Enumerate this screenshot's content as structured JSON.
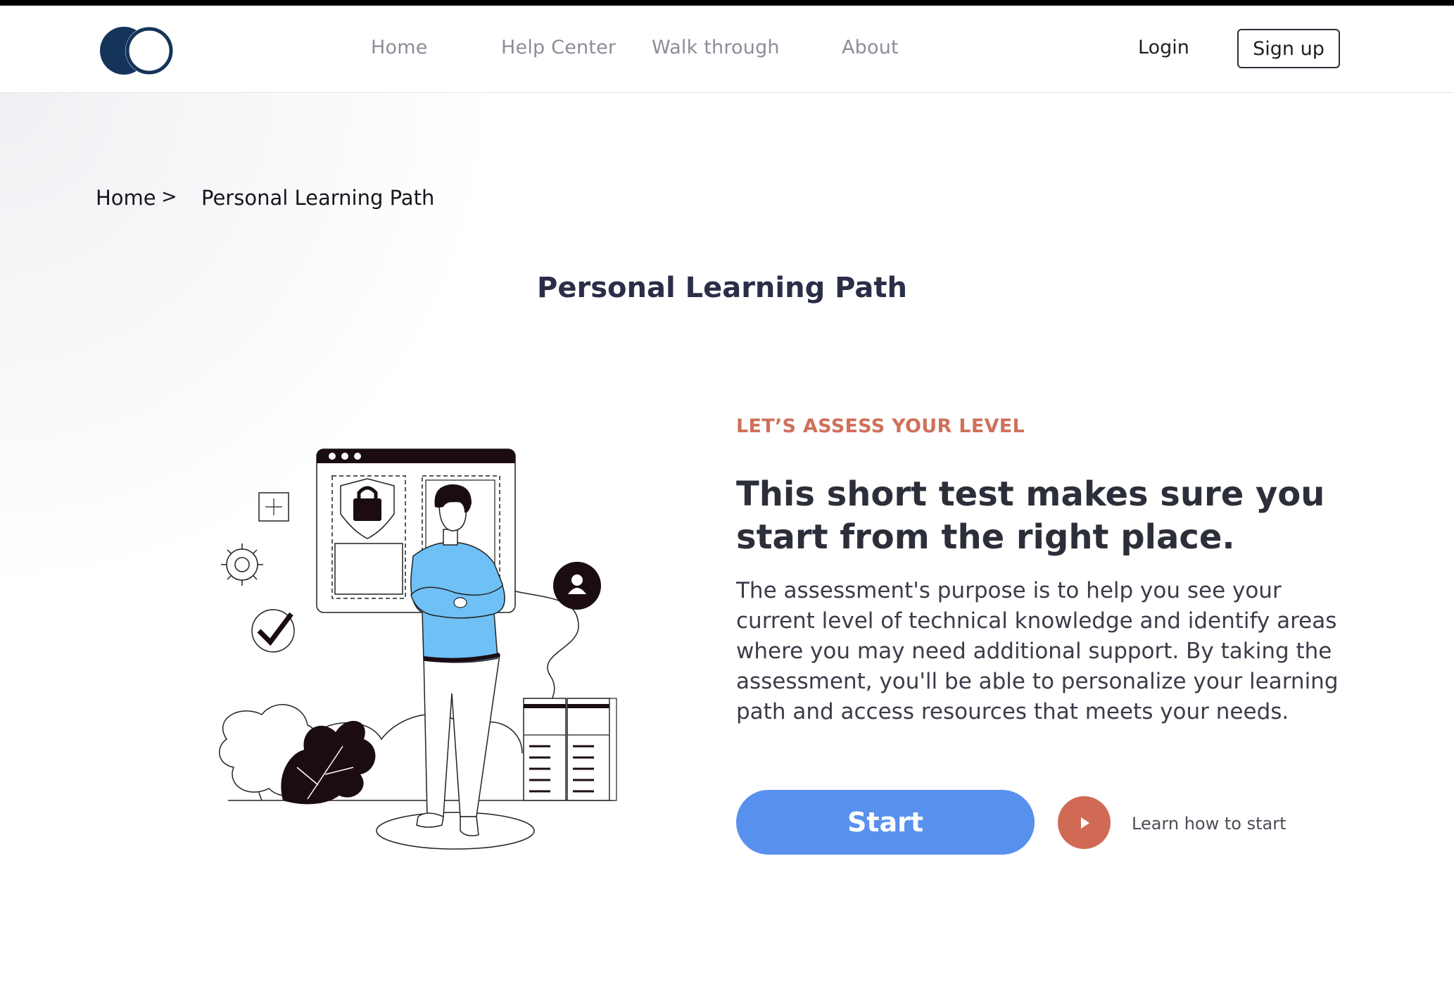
{
  "nav": {
    "links": [
      "Home",
      "Help Center",
      "Walk through",
      "About"
    ],
    "login": "Login",
    "signup": "Sign up"
  },
  "breadcrumb": {
    "home": "Home",
    "separator": ">",
    "current": "Personal Learning Path"
  },
  "page": {
    "title": "Personal Learning Path"
  },
  "assessment": {
    "eyebrow": "LET’S ASSESS YOUR LEVEL",
    "headline": "This short test makes sure you start from the right place.",
    "description": "The assessment's purpose is to help you see your current level of technical knowledge and identify areas where you may need additional support. By taking the assessment, you'll be able to personalize your learning path and access resources that meets your needs.",
    "start_label": "Start",
    "learn_label": "Learn how to start"
  },
  "icons": {
    "logo": "overlapping-circles-logo",
    "play": "play-icon"
  },
  "colors": {
    "primary": "#5890ee",
    "accent": "#d0705a",
    "title": "#2a2e47",
    "logo": "#14345a",
    "figure_shirt": "#6ec0f5"
  }
}
